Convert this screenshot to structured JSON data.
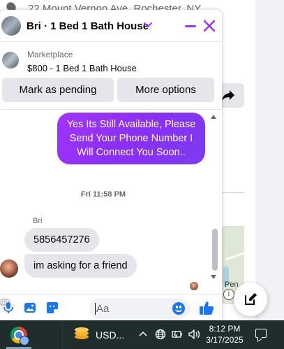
{
  "background": {
    "address": "22 Mount Vernon Ave, Rochester, NY",
    "map_label": "Pen",
    "map_info": "i"
  },
  "chat": {
    "title": "Bri · 1 Bed 1 Bath House",
    "accent_color": "#a033ff",
    "listing": {
      "source": "Marketplace",
      "title": "$800 - 1 Bed 1 Bath House"
    },
    "actions": {
      "mark_pending": "Mark as pending",
      "more_options": "More options"
    },
    "messages": {
      "outgoing": {
        "lines": [
          "Yes Its Still Available, Please",
          "Send Your Phone Number I",
          "Will Connect You Soon.."
        ],
        "color": "#8a2ff5"
      },
      "timestamp": "Fri 11:58 PM",
      "sender": "Bri",
      "incoming": [
        "5856457276",
        "im asking for a friend"
      ]
    },
    "composer": {
      "placeholder": "Aa",
      "gif_label": "GIF",
      "icon_color": "#1877f2"
    }
  },
  "taskbar": {
    "app_label": "USD...",
    "clock_time": "8:12 PM",
    "clock_date": "3/17/2025"
  }
}
